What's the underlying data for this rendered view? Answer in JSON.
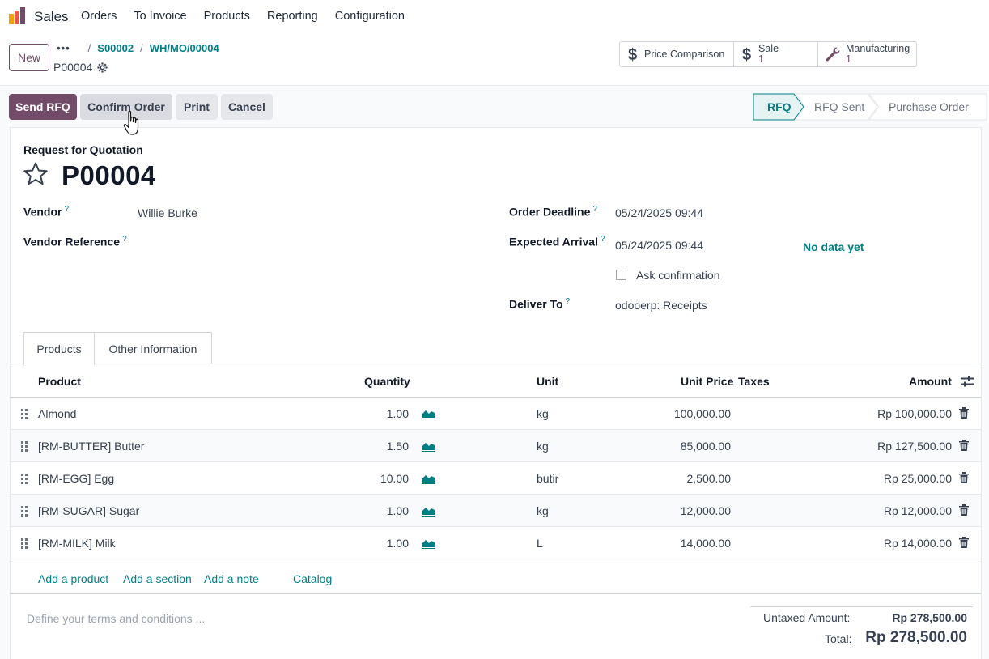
{
  "app": {
    "name": "Sales",
    "menu": [
      "Orders",
      "To Invoice",
      "Products",
      "Reporting",
      "Configuration"
    ]
  },
  "controlpanel": {
    "new_label": "New",
    "breadcrumb": {
      "dots": "•••",
      "items": [
        "S00002",
        "WH/MO/00004"
      ]
    },
    "record_name": "P00004",
    "smart_buttons": [
      {
        "label": "Price Comparison",
        "count": "",
        "icon": "dollar-icon"
      },
      {
        "label": "Sale",
        "count": "1",
        "icon": "dollar-icon"
      },
      {
        "label": "Manufacturing",
        "count": "1",
        "icon": "wrench-icon"
      }
    ]
  },
  "actions": {
    "send_rfq": "Send RFQ",
    "confirm": "Confirm Order",
    "print": "Print",
    "cancel": "Cancel"
  },
  "stages": [
    "RFQ",
    "RFQ Sent",
    "Purchase Order"
  ],
  "form": {
    "doc_label": "Request for Quotation",
    "doc_title": "P00004",
    "vendor_label": "Vendor",
    "vendor": "Willie Burke",
    "vendor_ref_label": "Vendor Reference",
    "deadline_label": "Order Deadline",
    "deadline": "05/24/2025 09:44",
    "arrival_label": "Expected Arrival",
    "arrival": "05/24/2025 09:44",
    "no_data": "No data yet",
    "ask_confirmation": "Ask confirmation",
    "deliver_label": "Deliver To",
    "deliver_to": "odooerp: Receipts",
    "help_mark": "?"
  },
  "tabs": [
    "Products",
    "Other Information"
  ],
  "table": {
    "headers": {
      "product": "Product",
      "quantity": "Quantity",
      "unit": "Unit",
      "unit_price": "Unit Price",
      "taxes": "Taxes",
      "amount": "Amount"
    },
    "rows": [
      {
        "product": "Almond",
        "quantity": "1.00",
        "unit": "kg",
        "unit_price": "100,000.00",
        "amount": "Rp 100,000.00"
      },
      {
        "product": "[RM-BUTTER] Butter",
        "quantity": "1.50",
        "unit": "kg",
        "unit_price": "85,000.00",
        "amount": "Rp 127,500.00"
      },
      {
        "product": "[RM-EGG] Egg",
        "quantity": "10.00",
        "unit": "butir",
        "unit_price": "2,500.00",
        "amount": "Rp 25,000.00"
      },
      {
        "product": "[RM-SUGAR] Sugar",
        "quantity": "1.00",
        "unit": "kg",
        "unit_price": "12,000.00",
        "amount": "Rp 12,000.00"
      },
      {
        "product": "[RM-MILK] Milk",
        "quantity": "1.00",
        "unit": "L",
        "unit_price": "14,000.00",
        "amount": "Rp 14,000.00"
      }
    ],
    "add_links": [
      "Add a product",
      "Add a section",
      "Add a note",
      "Catalog"
    ]
  },
  "footer": {
    "terms_placeholder": "Define your terms and conditions ...",
    "untaxed_label": "Untaxed Amount:",
    "untaxed": "Rp 278,500.00",
    "total_label": "Total:",
    "total": "Rp 278,500.00"
  },
  "colors": {
    "brand": "#714b67",
    "accent": "#017e84"
  }
}
